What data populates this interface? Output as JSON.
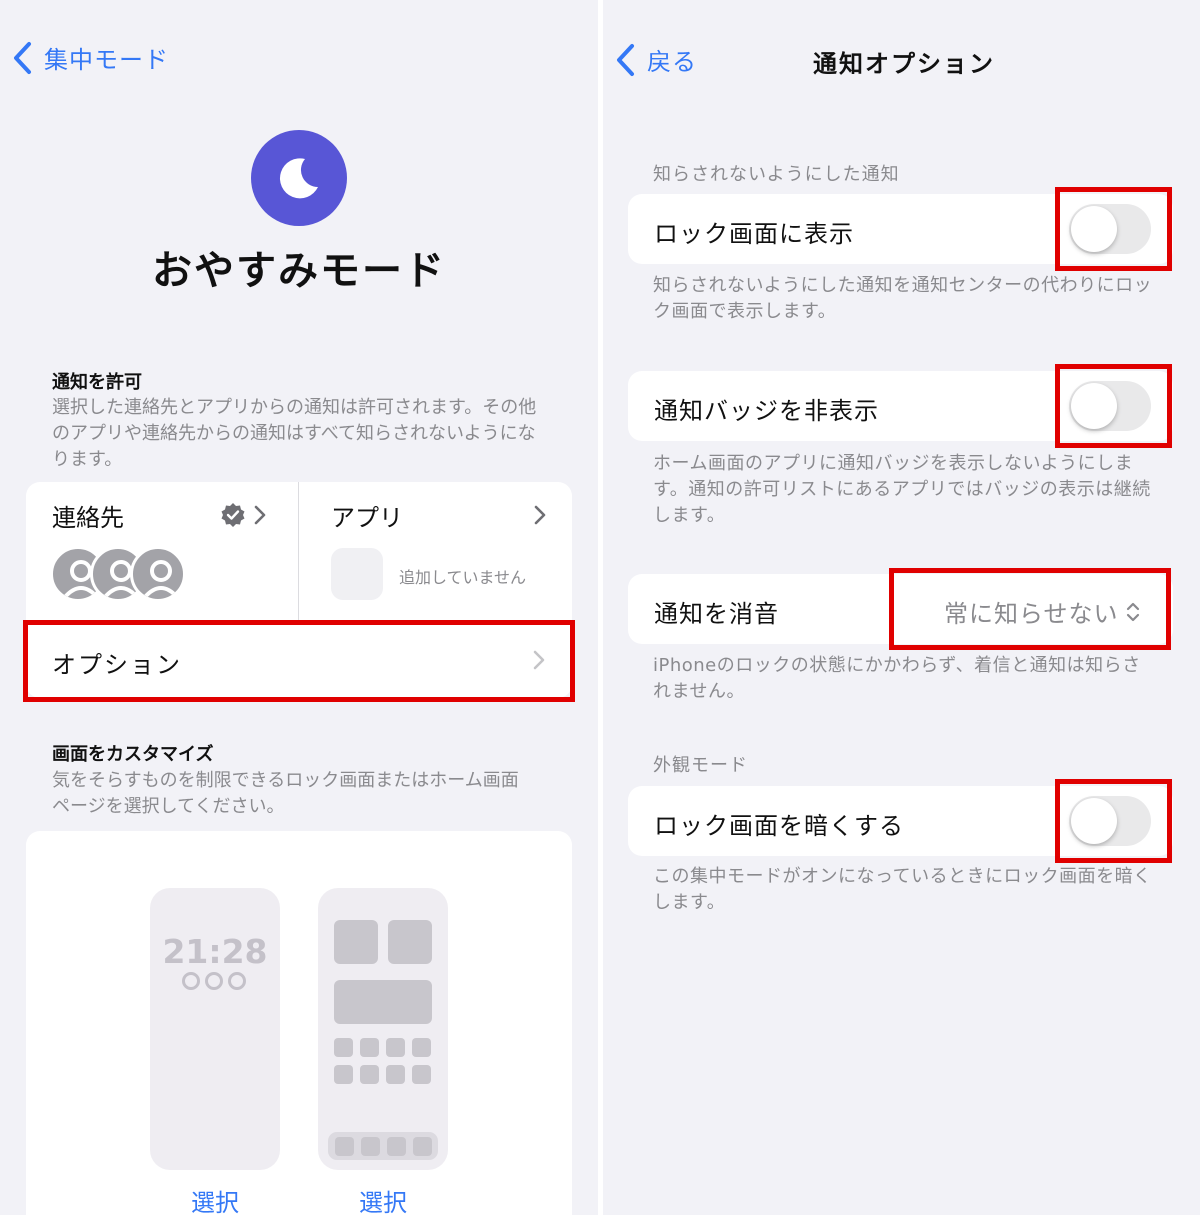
{
  "left": {
    "back_label": "集中モード",
    "focus_title": "おやすみモード",
    "allowed": {
      "title": "通知を許可",
      "description": "選択した連絡先とアプリからの通知は許可されます。その他のアプリや連絡先からの通知はすべて知らされないようになります。",
      "contacts_label": "連絡先",
      "apps_label": "アプリ",
      "apps_empty": "追加していません",
      "options_label": "オプション"
    },
    "customize": {
      "title": "画面をカスタマイズ",
      "description": "気をそらすものを制限できるロック画面またはホーム画面ページを選択してください。",
      "lock_time": "21:28",
      "select_lock": "選択",
      "select_home": "選択"
    }
  },
  "right": {
    "back_label": "戻る",
    "title": "通知オプション",
    "silenced_header": "知らされないようにした通知",
    "show_on_lock": {
      "label": "ロック画面に表示",
      "on": false,
      "footer": "知らされないようにした通知を通知センターの代わりにロック画面で表示します。"
    },
    "hide_badges": {
      "label": "通知バッジを非表示",
      "on": false,
      "footer": "ホーム画面のアプリに通知バッジを表示しないようにします。通知の許可リストにあるアプリではバッジの表示は継続します。"
    },
    "silence": {
      "label": "通知を消音",
      "value": "常に知らせない",
      "footer": "iPhoneのロックの状態にかかわらず、着信と通知は知らされません。"
    },
    "appearance_header": "外観モード",
    "dim_lock": {
      "label": "ロック画面を暗くする",
      "on": false,
      "footer": "この集中モードがオンになっているときにロック画面を暗くします。"
    }
  },
  "colors": {
    "accent": "#3478f6",
    "focus_purple": "#5856d6",
    "highlight_red": "#e00000",
    "background": "#f2f2f7"
  }
}
